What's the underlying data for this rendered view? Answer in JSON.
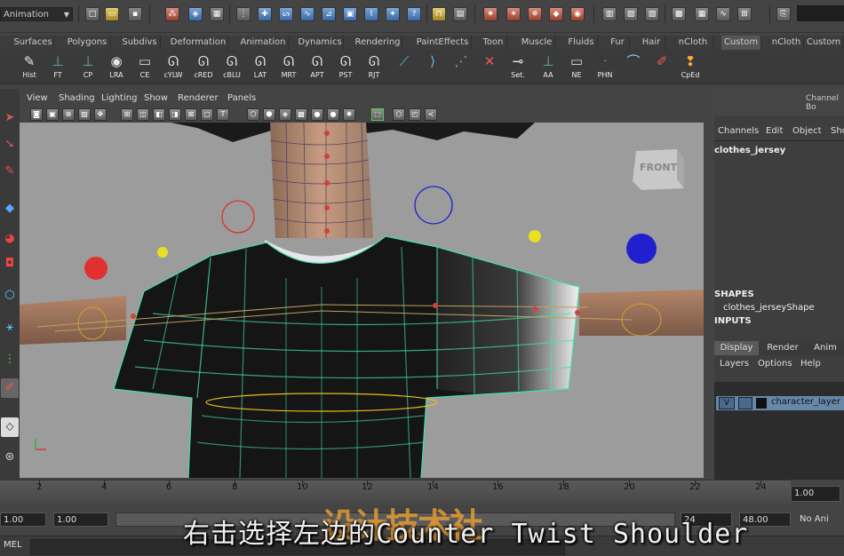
{
  "status_line": {
    "mode": "Animation"
  },
  "shelf_tabs": [
    "Surfaces",
    "Polygons",
    "Subdivs",
    "Deformation",
    "Animation",
    "Dynamics",
    "Rendering",
    "PaintEffects",
    "Toon",
    "Muscle",
    "Fluids",
    "Fur",
    "Hair",
    "nCloth",
    "Custom",
    "nCloth",
    "Custom"
  ],
  "shelf_buttons": [
    "Hist",
    "FT",
    "CP",
    "LRA",
    "CE",
    "cYLW",
    "cRED",
    "cBLU",
    "LAT",
    "MRT",
    "APT",
    "PST",
    "RJT",
    "",
    "",
    "",
    "",
    "Set.",
    "AA",
    "NE",
    "PHN",
    "",
    "",
    "CpEd"
  ],
  "viewport": {
    "menu": [
      "View",
      "Shading",
      "Lighting",
      "Show",
      "Renderer",
      "Panels"
    ],
    "view_cube": "FRONT"
  },
  "channel_box": {
    "title": "Channel Bo",
    "menu": [
      "Channels",
      "Edit",
      "Object",
      "Sho"
    ],
    "object_name": "clothes_jersey",
    "shapes_header": "SHAPES",
    "shape_name": "clothes_jerseyShape",
    "inputs_header": "INPUTS",
    "layer_tabs": [
      "Display",
      "Render",
      "Anim"
    ],
    "layer_menu": [
      "Layers",
      "Options",
      "Help"
    ],
    "layer_visible": "V",
    "layer_name": "character_layer"
  },
  "timeline": {
    "ticks": [
      "2",
      "4",
      "6",
      "8",
      "10",
      "12",
      "14",
      "16",
      "18",
      "20",
      "22",
      "24"
    ],
    "current_frame": "1.00"
  },
  "range": {
    "start": "1.00",
    "start_inner": "1.00",
    "end_inner": "24",
    "end": "48.00",
    "anim_layer": "No Ani"
  },
  "mel": {
    "label": "MEL"
  },
  "overlay": {
    "subtitle": "右击选择左边的Counter Twist Shoulder",
    "watermark": "设计技术社"
  },
  "colors": {
    "mesh_wire": "#44e0a8",
    "control_red": "#e03030",
    "control_blue": "#2020d0",
    "control_yellow": "#e8e020",
    "viewport_bg": "#9c9c9c"
  }
}
